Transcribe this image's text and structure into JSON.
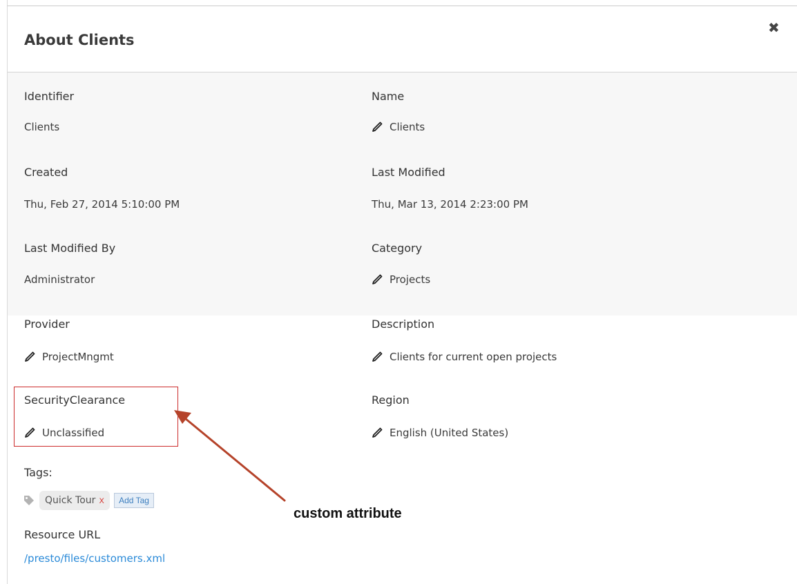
{
  "dialog": {
    "title": "About Clients",
    "close_glyph": "✖",
    "close_icon": "close-icon"
  },
  "fields": {
    "identifier": {
      "label": "Identifier",
      "value": "Clients",
      "editable": false
    },
    "name": {
      "label": "Name",
      "value": "Clients",
      "editable": true
    },
    "created": {
      "label": "Created",
      "value": "Thu, Feb 27, 2014 5:10:00 PM",
      "editable": false
    },
    "last_modified": {
      "label": "Last Modified",
      "value": "Thu, Mar 13, 2014 2:23:00 PM",
      "editable": false
    },
    "last_modified_by": {
      "label": "Last Modified By",
      "value": "Administrator",
      "editable": false
    },
    "category": {
      "label": "Category",
      "value": "Projects",
      "editable": true
    },
    "provider": {
      "label": "Provider",
      "value": "ProjectMngmt",
      "editable": true
    },
    "description": {
      "label": "Description",
      "value": "Clients for current open projects",
      "editable": true
    },
    "security_clearance": {
      "label": "SecurityClearance",
      "value": "Unclassified",
      "editable": true
    },
    "region": {
      "label": "Region",
      "value": "English (United States)",
      "editable": true
    }
  },
  "tags": {
    "label": "Tags:",
    "items": [
      {
        "label": "Quick Tour",
        "remove_glyph": "x"
      }
    ],
    "add_label": "Add Tag",
    "icon": "tag-icon"
  },
  "resource": {
    "label": "Resource URL",
    "url": "/presto/files/customers.xml"
  },
  "annotation": {
    "text": "custom attribute",
    "color": "#cc2b2b",
    "arrow_color": "#b5432a"
  },
  "colors": {
    "link": "#2a8ad8",
    "highlight": "#cc2b2b",
    "gray_panel": "#f7f7f7"
  }
}
